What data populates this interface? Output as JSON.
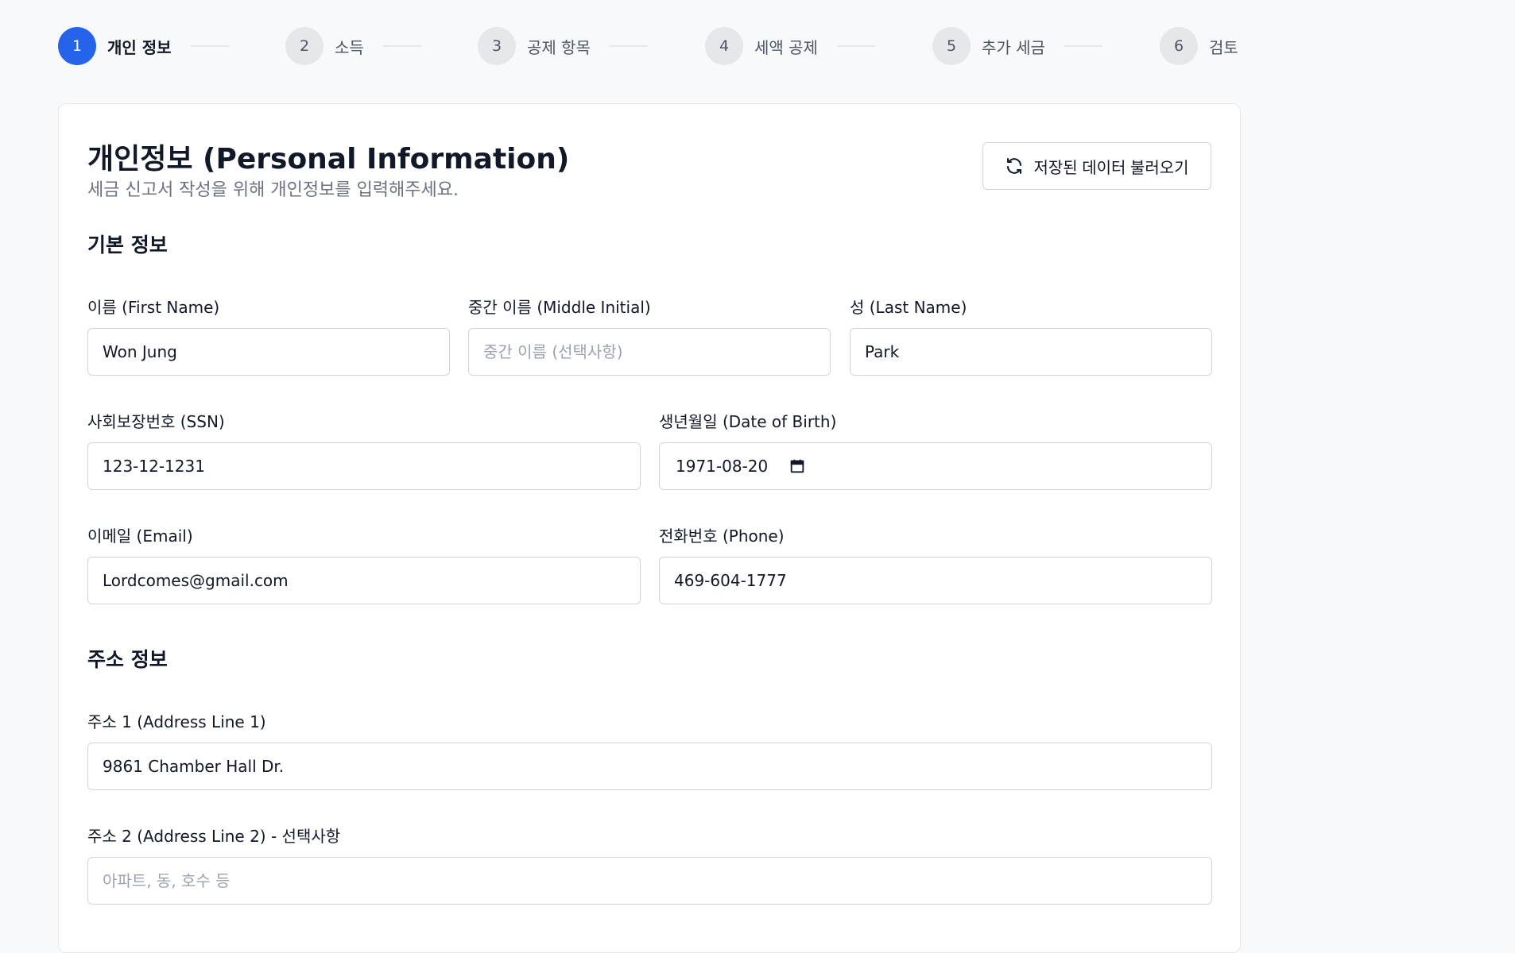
{
  "stepper": {
    "steps": [
      {
        "number": "1",
        "label": "개인 정보"
      },
      {
        "number": "2",
        "label": "소득"
      },
      {
        "number": "3",
        "label": "공제 항목"
      },
      {
        "number": "4",
        "label": "세액 공제"
      },
      {
        "number": "5",
        "label": "추가 세금"
      },
      {
        "number": "6",
        "label": "검토"
      }
    ],
    "active_step": "1"
  },
  "header": {
    "title": "개인정보 (Personal Information)",
    "subtitle": "세금 신고서 작성을 위해 개인정보를 입력해주세요.",
    "load_button_label": "저장된 데이터 불러오기",
    "load_button_icon": "refresh-icon"
  },
  "basic_info": {
    "section_title": "기본 정보",
    "first_name": {
      "label": "이름 (First Name)",
      "value": "Won Jung",
      "placeholder": ""
    },
    "middle_initial": {
      "label": "중간 이름 (Middle Initial)",
      "value": "",
      "placeholder": "중간 이름 (선택사항)"
    },
    "last_name": {
      "label": "성 (Last Name)",
      "value": "Park",
      "placeholder": ""
    },
    "ssn": {
      "label": "사회보장번호 (SSN)",
      "value": "123-12-1231"
    },
    "dob": {
      "label": "생년월일 (Date of Birth)",
      "value": "1971-08-20",
      "icon": "calendar-icon"
    },
    "email": {
      "label": "이메일 (Email)",
      "value": "Lordcomes@gmail.com"
    },
    "phone": {
      "label": "전화번호 (Phone)",
      "value": "469-604-1777"
    }
  },
  "address_info": {
    "section_title": "주소 정보",
    "address1": {
      "label": "주소 1 (Address Line 1)",
      "value": "9861 Chamber Hall Dr."
    },
    "address2": {
      "label": "주소 2 (Address Line 2) - 선택사항",
      "value": "",
      "placeholder": "아파트, 동, 호수 등"
    }
  },
  "colors": {
    "accent": "#2563eb",
    "step_inactive_bg": "#e5e7eb",
    "page_bg": "#f8f9fb",
    "subtitle": "#6b7280"
  }
}
